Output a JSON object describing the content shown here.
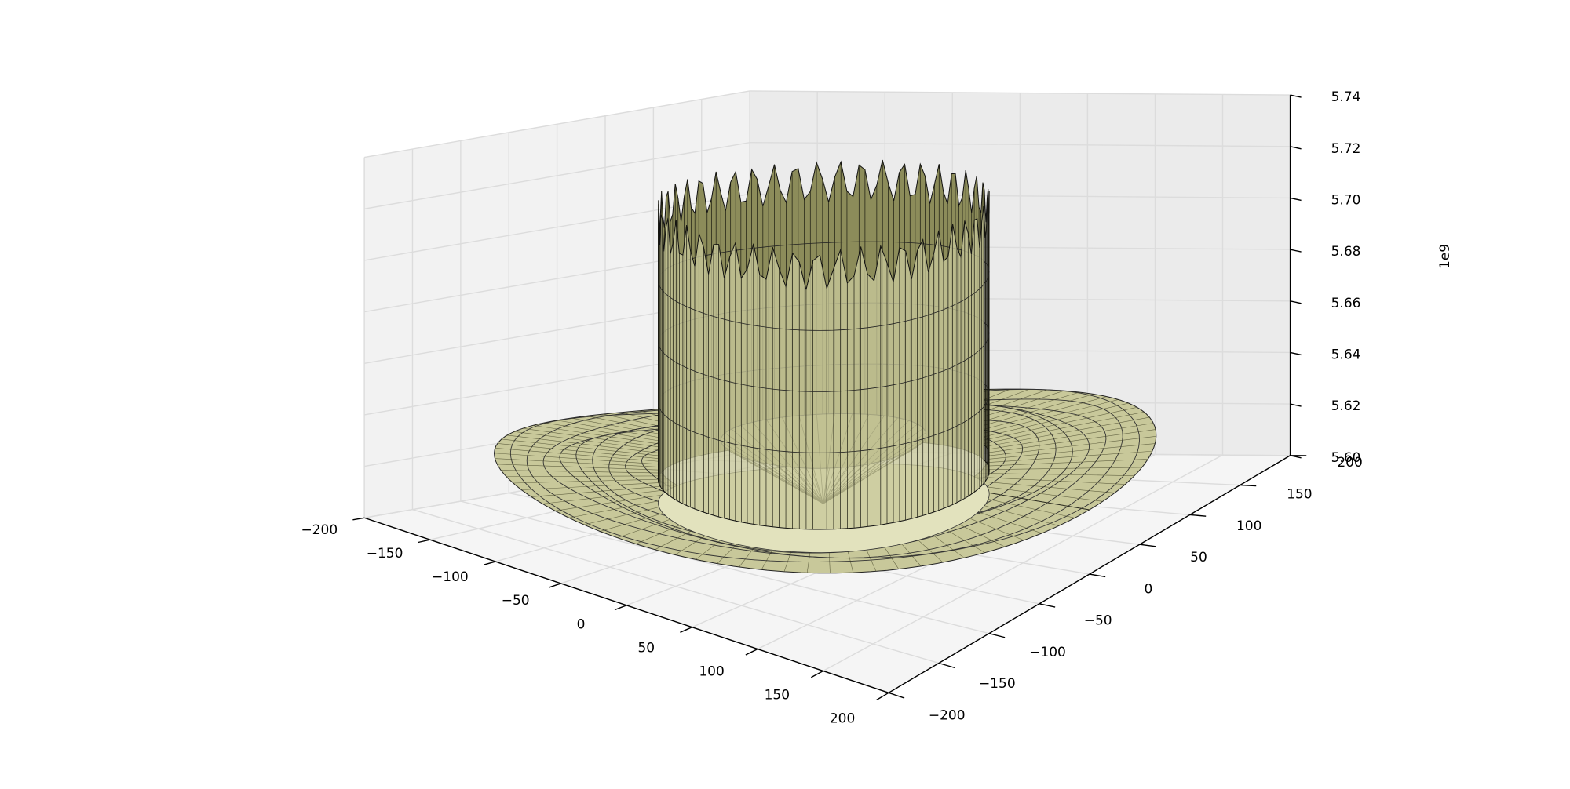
{
  "chart_data": {
    "type": "surface3d",
    "title": "",
    "xlabel": "",
    "ylabel": "",
    "zlabel": "",
    "x_ticks": [
      "−200",
      "−150",
      "−100",
      "−50",
      "0",
      "50",
      "100",
      "150",
      "200"
    ],
    "y_ticks": [
      "−200",
      "−150",
      "−100",
      "−50",
      "0",
      "50",
      "100",
      "150",
      "200"
    ],
    "z_ticks": [
      "5.60",
      "5.62",
      "5.64",
      "5.66",
      "5.68",
      "5.70",
      "5.72",
      "5.74"
    ],
    "z_offset": "1e9",
    "xlim": [
      -200,
      200
    ],
    "ylim": [
      -200,
      200
    ],
    "zlim": [
      5600000000.0,
      5740000000.0
    ],
    "grid": true,
    "surface": {
      "shape": "axisymmetric ring structure",
      "outer_disc_radius": 200,
      "inner_wall_radius": 100,
      "outer_disc_value": 5625000000.0,
      "wall_top_value": 5720000000.0,
      "center_dip_value": 5610000000.0,
      "face_color": "#c8c89a",
      "edge_color": "#000000"
    }
  },
  "colors": {
    "pane_back": "#ebebeb",
    "pane_side": "#f2f2f2",
    "pane_floor": "#f5f5f5",
    "grid": "#dcdcdc",
    "surface_face": "#c8c89a",
    "surface_shadow": "#8c8c5a",
    "surface_light": "#e2e2bd"
  }
}
